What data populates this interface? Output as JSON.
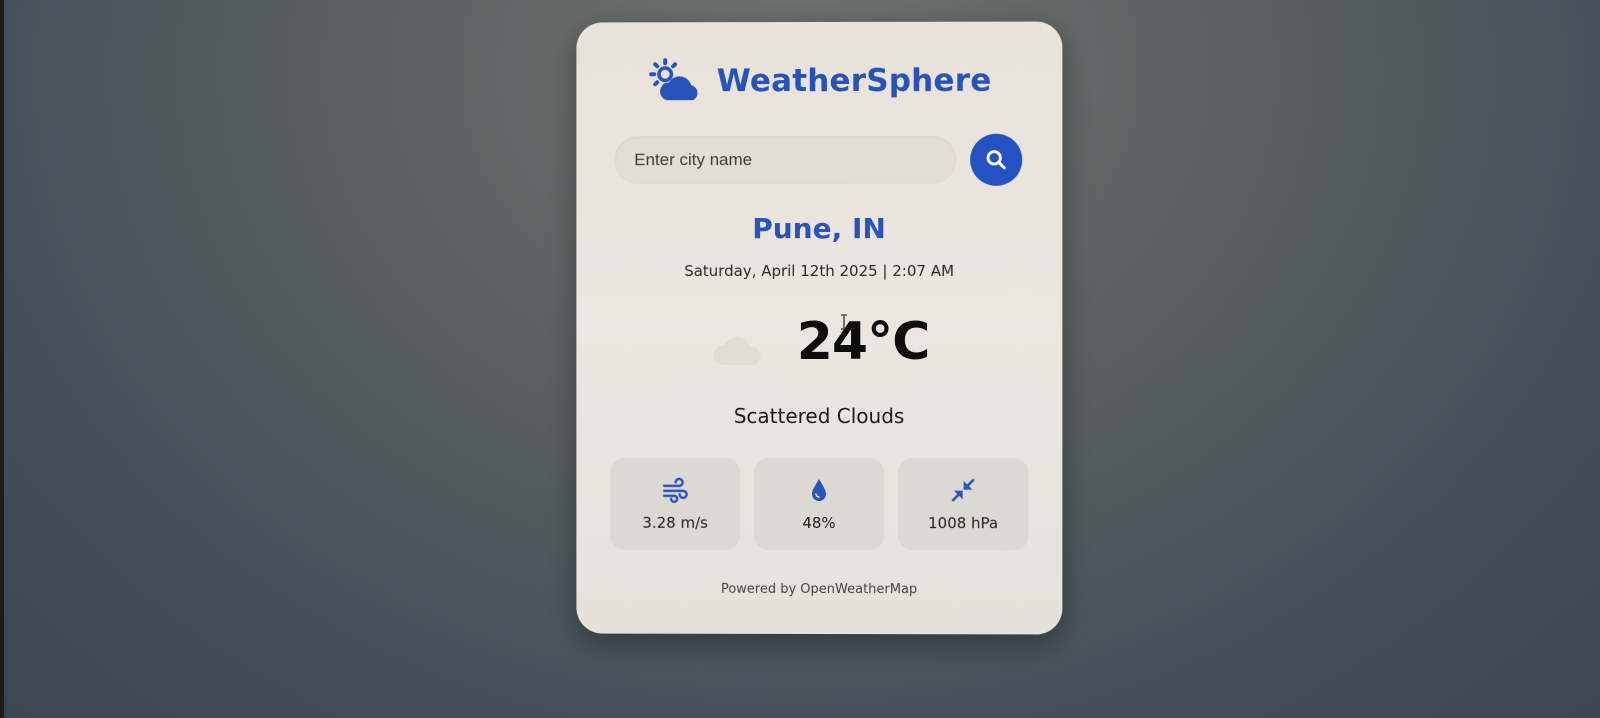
{
  "app": {
    "title": "WeatherSphere"
  },
  "search": {
    "placeholder": "Enter city name",
    "value": ""
  },
  "location": {
    "city": "Pune, IN",
    "datetime": "Saturday, April 12th 2025 | 2:07 AM"
  },
  "current": {
    "temperature": "24°C",
    "description": "Scattered Clouds",
    "icon": "cloud-icon"
  },
  "stats": {
    "wind": {
      "icon": "wind-icon",
      "value": "3.28 m/s"
    },
    "humidity": {
      "icon": "droplet-icon",
      "value": "48%"
    },
    "pressure": {
      "icon": "compress-icon",
      "value": "1008 hPa"
    }
  },
  "footer": {
    "text": "Powered by OpenWeatherMap"
  },
  "colors": {
    "accent": "#2552c0",
    "card_bg": "#e8e2da",
    "stat_bg": "#dcd8d4"
  }
}
